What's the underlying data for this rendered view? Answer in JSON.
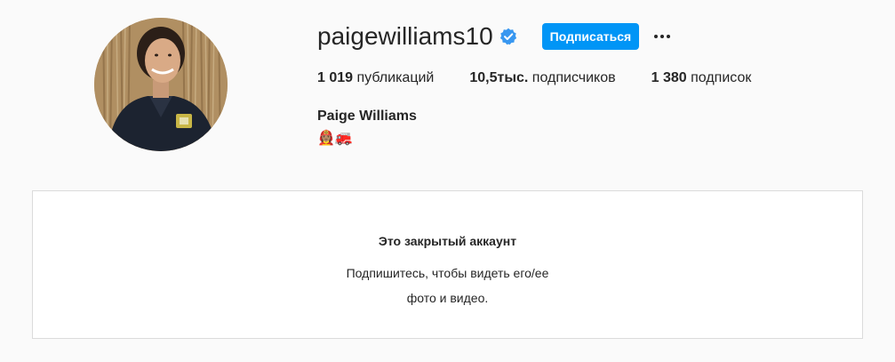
{
  "profile": {
    "username": "paigewilliams10",
    "verified": true,
    "follow_label": "Подписаться",
    "full_name": "Paige Williams",
    "bio": "👩🏽‍🚒🚒",
    "stats": {
      "posts_count": "1 019",
      "posts_label": "публикаций",
      "followers_count": "10,5тыс.",
      "followers_label": "подписчиков",
      "following_count": "1 380",
      "following_label": "подписок"
    }
  },
  "private_account": {
    "title": "Это закрытый аккаунт",
    "text": "Подпишитесь, чтобы видеть его/ее фото и видео."
  },
  "colors": {
    "accent": "#0095f6",
    "background": "#fafafa",
    "verified": "#3897f0"
  },
  "icons": {
    "verified": "verified-badge-icon",
    "more": "more-options-icon"
  }
}
